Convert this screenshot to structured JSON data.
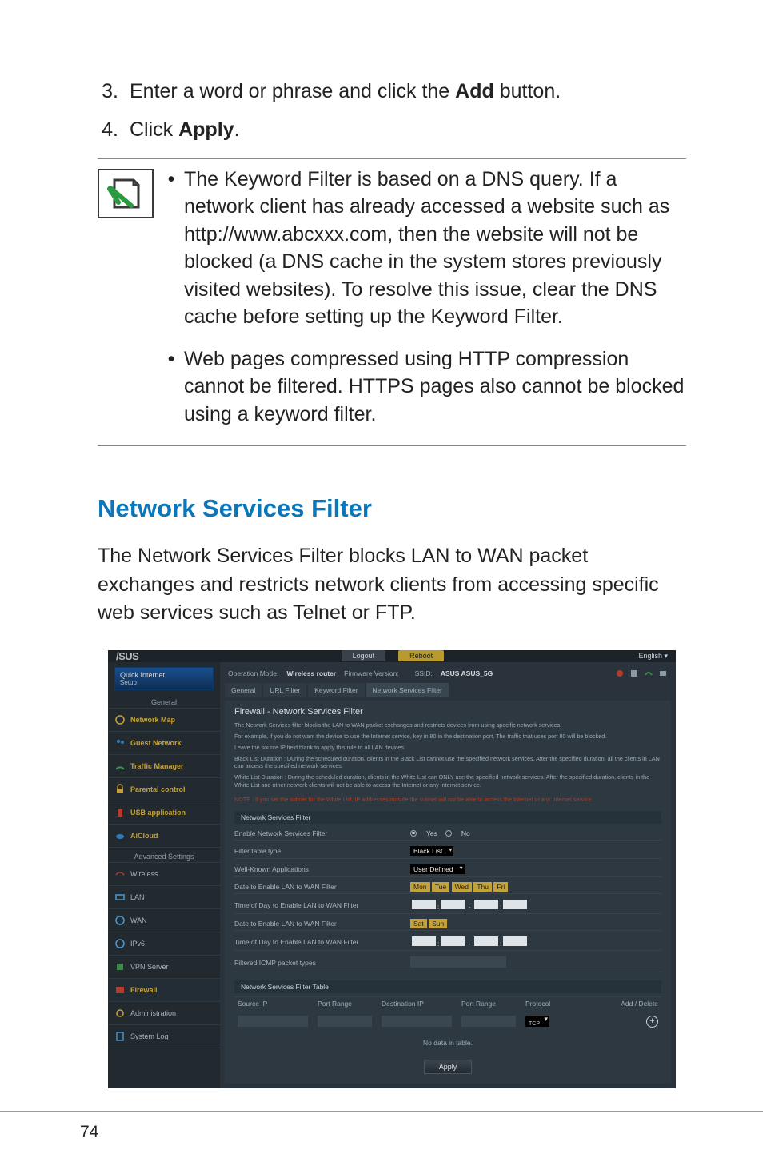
{
  "steps": {
    "s3": {
      "num": "3.",
      "pre": "Enter a word or phrase and click the ",
      "bold": "Add",
      "post": " button."
    },
    "s4": {
      "num": "4.",
      "pre": "Click ",
      "bold": "Apply",
      "post": "."
    }
  },
  "notes": {
    "n1": "The Keyword Filter is based on a DNS query. If a network client has already accessed a website such as http://www.abcxxx.com, then the website will not be blocked (a DNS cache in the system stores previously visited websites). To resolve this issue, clear the DNS cache before setting up the Keyword Filter.",
    "n2": "Web pages compressed using HTTP compression cannot be filtered. HTTPS pages also cannot be blocked using a keyword filter."
  },
  "section_h": "Network Services Filter",
  "section_p": "The Network Services Filter blocks LAN to WAN packet exchanges and restricts network clients from accessing specific web services such as Telnet or FTP.",
  "page_number": "74",
  "ui": {
    "logo": "/SUS",
    "top": {
      "logout": "Logout",
      "reboot": "Reboot",
      "lang": "English"
    },
    "info": {
      "mode_lbl": "Operation Mode:",
      "mode_val": "Wireless router",
      "fw_lbl": "Firmware Version:",
      "fw_val": "",
      "ssid_lbl": "SSID:",
      "ssid_val": "ASUS ASUS_5G"
    },
    "tabs": [
      "General",
      "URL Filter",
      "Keyword Filter",
      "Network Services Filter"
    ],
    "quick": {
      "l1": "Quick Internet",
      "l2": "Setup"
    },
    "cat1": "General",
    "cat2": "Advanced Settings",
    "side1": [
      "Network Map",
      "Guest Network",
      "Traffic Manager",
      "Parental control",
      "USB application",
      "AiCloud"
    ],
    "side2": [
      "Wireless",
      "LAN",
      "WAN",
      "IPv6",
      "VPN Server",
      "Firewall",
      "Administration",
      "System Log"
    ],
    "panel": {
      "title": "Firewall - Network Services Filter",
      "d1": "The Network Services filter blocks the LAN to WAN packet exchanges and restricts devices from using specific network services.",
      "d2": "For example, if you do not want the device to use the Internet service, key in 80 in the destination port. The traffic that uses port 80 will be blocked.",
      "d3": "Leave the source IP field blank to apply this rule to all LAN devices.",
      "d4": "Black List Duration : During the scheduled duration, clients in the Black List cannot use the specified network services. After the specified duration, all the clients in LAN can access the specified network services.",
      "d5": "White List Duration : During the scheduled duration, clients in the White List can ONLY use the specified network services. After the specified duration, clients in the White List and other network clients will not be able to access the Internet or any Internet service.",
      "warn": "NOTE : If you set the subnet for the White List, IP addresses outside the subnet will not be able to access the Internet or any Internet service.",
      "bar": "Network Services Filter",
      "rows": {
        "r1_lbl": "Enable Network Services Filter",
        "yes": "Yes",
        "no": "No",
        "r2_lbl": "Filter table type",
        "r2_val": "Black List",
        "r3_lbl": "Well-Known Applications",
        "r3_val": "User Defined",
        "r4_lbl": "Date to Enable LAN to WAN Filter",
        "r5_lbl": "Time of Day to Enable LAN to WAN Filter",
        "r6_lbl": "Date to Enable LAN to WAN Filter",
        "r7_lbl": "Time of Day to Enable LAN to WAN Filter",
        "r8_lbl": "Filtered ICMP packet types",
        "days": [
          "Mon",
          "Tue",
          "Wed",
          "Thu",
          "Fri"
        ],
        "days2": [
          "Sat",
          "Sun"
        ]
      },
      "tbar": "Network Services Filter Table",
      "th": [
        "Source IP",
        "Port Range",
        "Destination IP",
        "Port Range",
        "Protocol",
        "Add / Delete"
      ],
      "proto": "TCP",
      "nolist": "No data in table.",
      "apply": "Apply"
    }
  }
}
